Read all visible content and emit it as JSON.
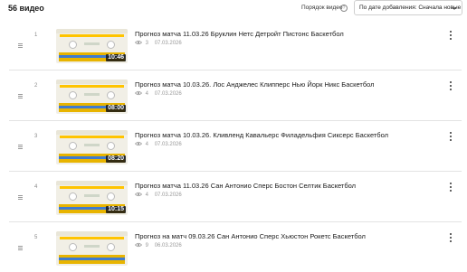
{
  "header": {
    "count_text": "56 видео",
    "sort_label": "Порядок видео",
    "sort_value": "По дате добавления: Сначала новые"
  },
  "icons": {
    "help": "help-circle-icon",
    "chevron": "chevron-down-icon",
    "drag": "drag-handle-icon",
    "views": "eye-icon",
    "more": "more-vertical-icon"
  },
  "colors": {
    "thumb_yellow": "#ffc400",
    "thumb_blue": "#3f7bd0",
    "duration_bg": "#141414"
  },
  "videos": [
    {
      "index": "1",
      "title": "Прогноз матча 11.03.26 Бруклин Нетс Детройт Пистонс Баскетбол",
      "views": "3",
      "date": "07.03.2026",
      "duration": "10:46"
    },
    {
      "index": "2",
      "title": "Прогноз матча 10.03.26. Лос Анджелес Клипперс Нью Йорк Никс Баскетбол",
      "views": "4",
      "date": "07.03.2026",
      "duration": "08:00"
    },
    {
      "index": "3",
      "title": "Прогноз матча 10.03.26. Кливленд Кавальерс Филадельфия Сиксерс Баскетбол",
      "views": "4",
      "date": "07.03.2026",
      "duration": "08:20"
    },
    {
      "index": "4",
      "title": "Прогноз матча 11.03.26 Сан Антонио Сперс Бостон Селтик Баскетбол",
      "views": "4",
      "date": "07.03.2026",
      "duration": "10:15"
    },
    {
      "index": "5",
      "title": "Прогноз на матч 09.03.26 Сан Антонио Сперс Хьюстон Рокетс Баскетбол",
      "views": "9",
      "date": "06.03.2026",
      "duration": ""
    }
  ]
}
